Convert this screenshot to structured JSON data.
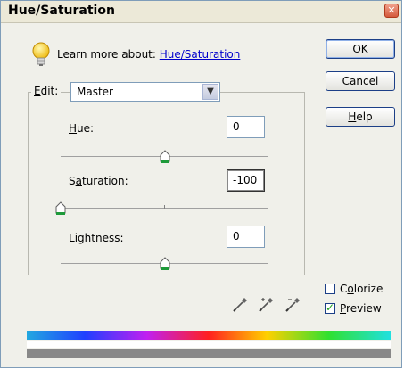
{
  "window": {
    "title": "Hue/Saturation",
    "close_glyph": "✕"
  },
  "learn_more": {
    "prefix": "Learn more about:",
    "link": "Hue/Saturation"
  },
  "buttons": {
    "ok": "OK",
    "cancel": "Cancel",
    "help_first": "H",
    "help_rest": "elp"
  },
  "edit": {
    "label_first": "E",
    "label_rest": "dit:",
    "selected": "Master",
    "arrow_glyph": "⌄"
  },
  "hue": {
    "label_first": "H",
    "label_rest": "ue:",
    "value": "0",
    "slider_fraction": 0.5
  },
  "saturation": {
    "label_first": "S",
    "label_second": "a",
    "label_rest": "turation:",
    "value": "-100",
    "slider_fraction": 0.0
  },
  "lightness": {
    "label_first": "L",
    "label_second": "i",
    "label_rest": "ghtness:",
    "value": "0",
    "slider_fraction": 0.5
  },
  "options": {
    "colorize": {
      "label_pre": "C",
      "label_acc": "o",
      "label_rest": "lorize",
      "checked": false
    },
    "preview": {
      "label_acc": "P",
      "label_rest": "review",
      "checked": true,
      "check_glyph": "✓"
    }
  },
  "icons": [
    "lightbulb-icon",
    "eyedropper-icon",
    "eyedropper-plus-icon",
    "eyedropper-minus-icon"
  ],
  "colors": {
    "slider_thumb": "#1e9a3a",
    "link": "#0000cc",
    "accent_border": "#1c3f87"
  }
}
